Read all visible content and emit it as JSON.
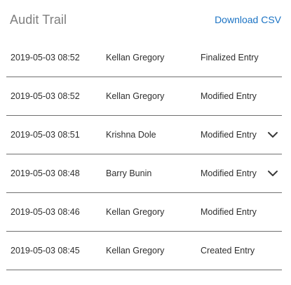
{
  "header": {
    "title": "Audit Trail",
    "download_label": "Download CSV"
  },
  "colors": {
    "title": "#7e7e7e",
    "link": "#1b73c4",
    "divider": "#707070",
    "text": "#2e2e2e"
  },
  "entries": [
    {
      "timestamp": "2019-05-03 08:52",
      "user": "Kellan Gregory",
      "action": "Finalized Entry",
      "expandable": false
    },
    {
      "timestamp": "2019-05-03 08:52",
      "user": "Kellan Gregory",
      "action": "Modified Entry",
      "expandable": false
    },
    {
      "timestamp": "2019-05-03 08:51",
      "user": "Krishna Dole",
      "action": "Modified Entry",
      "expandable": true,
      "icon": "chevron-down-icon"
    },
    {
      "timestamp": "2019-05-03 08:48",
      "user": "Barry Bunin",
      "action": "Modified Entry",
      "expandable": true,
      "icon": "chevron-down-icon"
    },
    {
      "timestamp": "2019-05-03 08:46",
      "user": "Kellan Gregory",
      "action": "Modified Entry",
      "expandable": false
    },
    {
      "timestamp": "2019-05-03 08:45",
      "user": "Kellan Gregory",
      "action": "Created Entry",
      "expandable": false
    }
  ]
}
